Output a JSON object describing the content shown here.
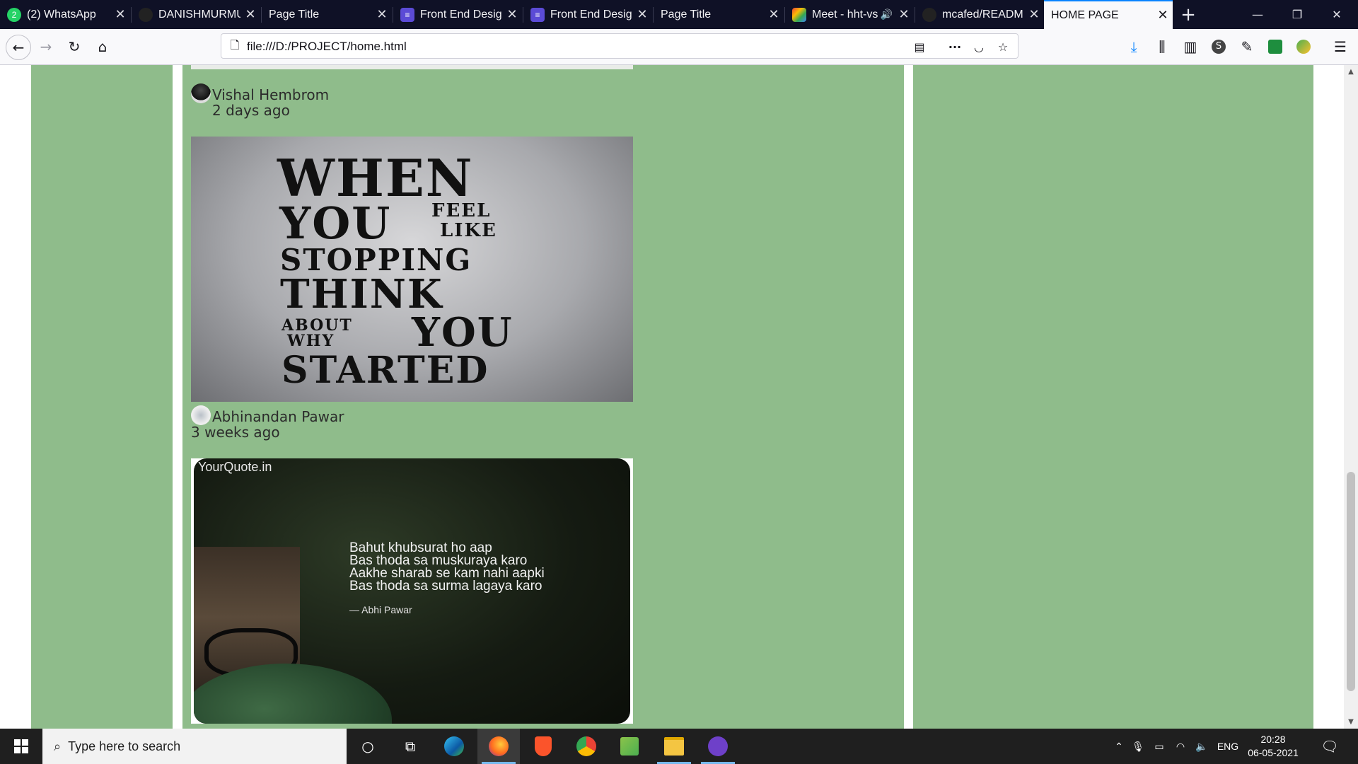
{
  "browser": {
    "tabs": [
      {
        "title": "(2) WhatsApp",
        "icon": "whatsapp-icon",
        "badge": "2",
        "color": "#25d366"
      },
      {
        "title": "DANISHMURMU",
        "icon": "github-icon",
        "color": "#222"
      },
      {
        "title": "Page Title",
        "icon": "",
        "color": ""
      },
      {
        "title": "Front End Design",
        "icon": "document-icon",
        "color": "#5b4bd6"
      },
      {
        "title": "Front End Design",
        "icon": "document-icon",
        "color": "#5b4bd6"
      },
      {
        "title": "Page Title",
        "icon": "",
        "color": ""
      },
      {
        "title": "Meet - hht-vs",
        "icon": "meet-icon",
        "color": "#00897b"
      },
      {
        "title": "mcafed/READM",
        "icon": "github-icon",
        "color": "#222"
      },
      {
        "title": "HOME PAGE",
        "icon": "",
        "color": "",
        "active": true
      }
    ],
    "url": "file:///D:/PROJECT/home.html"
  },
  "feed": {
    "posts": [
      {
        "author": "Vishal Hembrom",
        "time": "2 days ago",
        "image_text": [
          "WHEN",
          "YOU",
          "FEEL",
          "LIKE",
          "STOPPING",
          "THINK",
          "ABOUT",
          "WHY",
          "YOU",
          "STARTED"
        ]
      },
      {
        "author": "Abhinandan Pawar",
        "time": "3 weeks ago",
        "brand": "YourQuote.in",
        "poem": [
          "Bahut khubsurat ho aap",
          "Bas thoda sa muskuraya karo",
          "Aakhe sharab se kam nahi aapki",
          "Bas thoda sa surma lagaya karo"
        ],
        "poem_author": "— Abhi Pawar"
      }
    ]
  },
  "taskbar": {
    "search_placeholder": "Type here to search",
    "language": "ENG",
    "time": "20:28",
    "date": "06-05-2021"
  },
  "colors": {
    "page_green": "#8fbc8b",
    "tab_bar": "#0f1126",
    "taskbar": "#1f1f1f",
    "accent": "#0a84ff"
  }
}
